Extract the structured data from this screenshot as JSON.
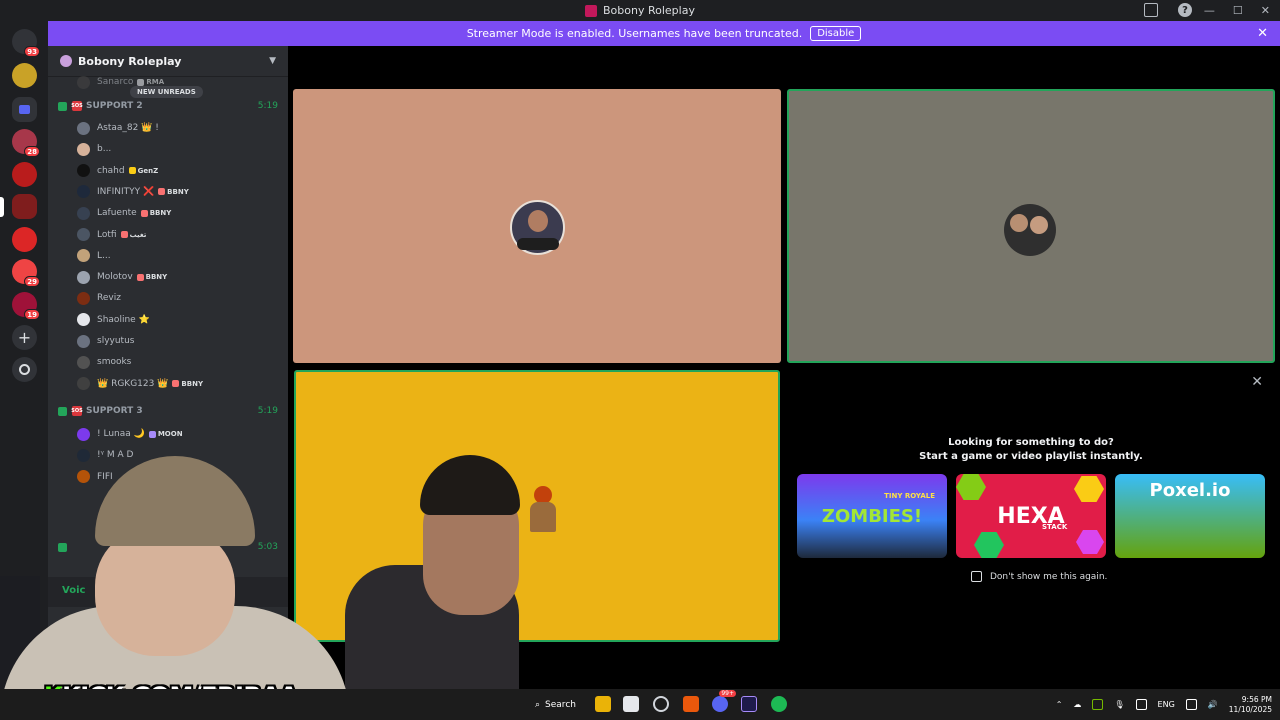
{
  "window": {
    "title": "Bobony Roleplay",
    "minimize": "—",
    "maximize": "☐",
    "close": "✕",
    "help": "?"
  },
  "banner": {
    "text": "Streamer Mode is enabled. Usernames have been truncated.",
    "button": "Disable",
    "close": "✕"
  },
  "guilds": [
    {
      "name": "discord-home",
      "badge": "93",
      "color": "#5865f2"
    },
    {
      "name": "server-1",
      "badge": "",
      "color": "#c9a227"
    },
    {
      "name": "folder",
      "badge": "",
      "color": "#5865f2"
    },
    {
      "name": "server-2",
      "badge": "28",
      "color": "#a7374a"
    },
    {
      "name": "server-3",
      "badge": "",
      "color": "#b91c1c"
    },
    {
      "name": "server-bobony",
      "badge": "",
      "color": "#7f1d1d"
    },
    {
      "name": "server-4",
      "badge": "",
      "color": "#dc2626"
    },
    {
      "name": "server-5",
      "badge": "29",
      "color": "#ef4444"
    },
    {
      "name": "server-6",
      "badge": "19",
      "color": "#9f1239"
    }
  ],
  "sidebar": {
    "server_name": "Bobony Roleplay",
    "new_unreads": "NEW UNREADS",
    "top_partial": {
      "name": "Sanarco",
      "tag": "RMA"
    },
    "support2": {
      "name": "SUPPORT 2",
      "time": "5:19"
    },
    "support2_members": [
      {
        "name": "Astaa_82 👑 !",
        "tag": "",
        "color": "#6b7280"
      },
      {
        "name": "b...",
        "tag": "",
        "color": "#d6b29a"
      },
      {
        "name": "chahd",
        "tag": "GenZ",
        "color": "#111"
      },
      {
        "name": "INFINITYY ❌",
        "tag": "BBNY",
        "color": "#1e293b"
      },
      {
        "name": "Lafuente",
        "tag": "BBNY",
        "color": "#374151"
      },
      {
        "name": "Lotfi",
        "tag": "تغيب",
        "color": "#4b5563"
      },
      {
        "name": "L...",
        "tag": "",
        "color": "#c2a27a"
      },
      {
        "name": "Molotov",
        "tag": "BBNY",
        "color": "#9ca3af"
      },
      {
        "name": "Reviz",
        "tag": "",
        "color": "#7c2d12"
      },
      {
        "name": "Shaoline ⭐",
        "tag": "",
        "color": "#e5e7eb"
      },
      {
        "name": "slyyutus",
        "tag": "",
        "color": "#6b7280"
      },
      {
        "name": "smooks",
        "tag": "",
        "color": "#525252"
      },
      {
        "name": "👑 RGKG123 👑",
        "tag": "BBNY",
        "color": "#404040"
      }
    ],
    "support3": {
      "name": "SUPPORT 3",
      "time": "5:19"
    },
    "support3_members": [
      {
        "name": "! Lunaa 🌙",
        "tag": "MOON",
        "color": "#7c3aed"
      },
      {
        "name": "!ᵞ M A D",
        "tag": "",
        "color": "#1f2937"
      },
      {
        "name": "FIFI",
        "tag": "",
        "color": "#b45309"
      }
    ],
    "locked_time": "5:03",
    "voice_label": "Voic"
  },
  "activity": {
    "line1": "Looking for something to do?",
    "line2": "Start a game or video playlist instantly.",
    "close": "✕",
    "games": [
      {
        "title": "ZOMBIES!",
        "subtitle": "TINY ROYALE"
      },
      {
        "title": "HEXA",
        "subtitle": "STACK"
      },
      {
        "title": "Poxel.io",
        "subtitle": ""
      }
    ],
    "dont_show": "Don't show me this again."
  },
  "overlay": {
    "kick_k": "K",
    "kick_text": "KICK.COM/FRIRAA"
  },
  "taskbar": {
    "search": "Search",
    "discord_badge": "99+",
    "lang": "ENG",
    "time": "9:56 PM",
    "date": "11/10/2025"
  }
}
